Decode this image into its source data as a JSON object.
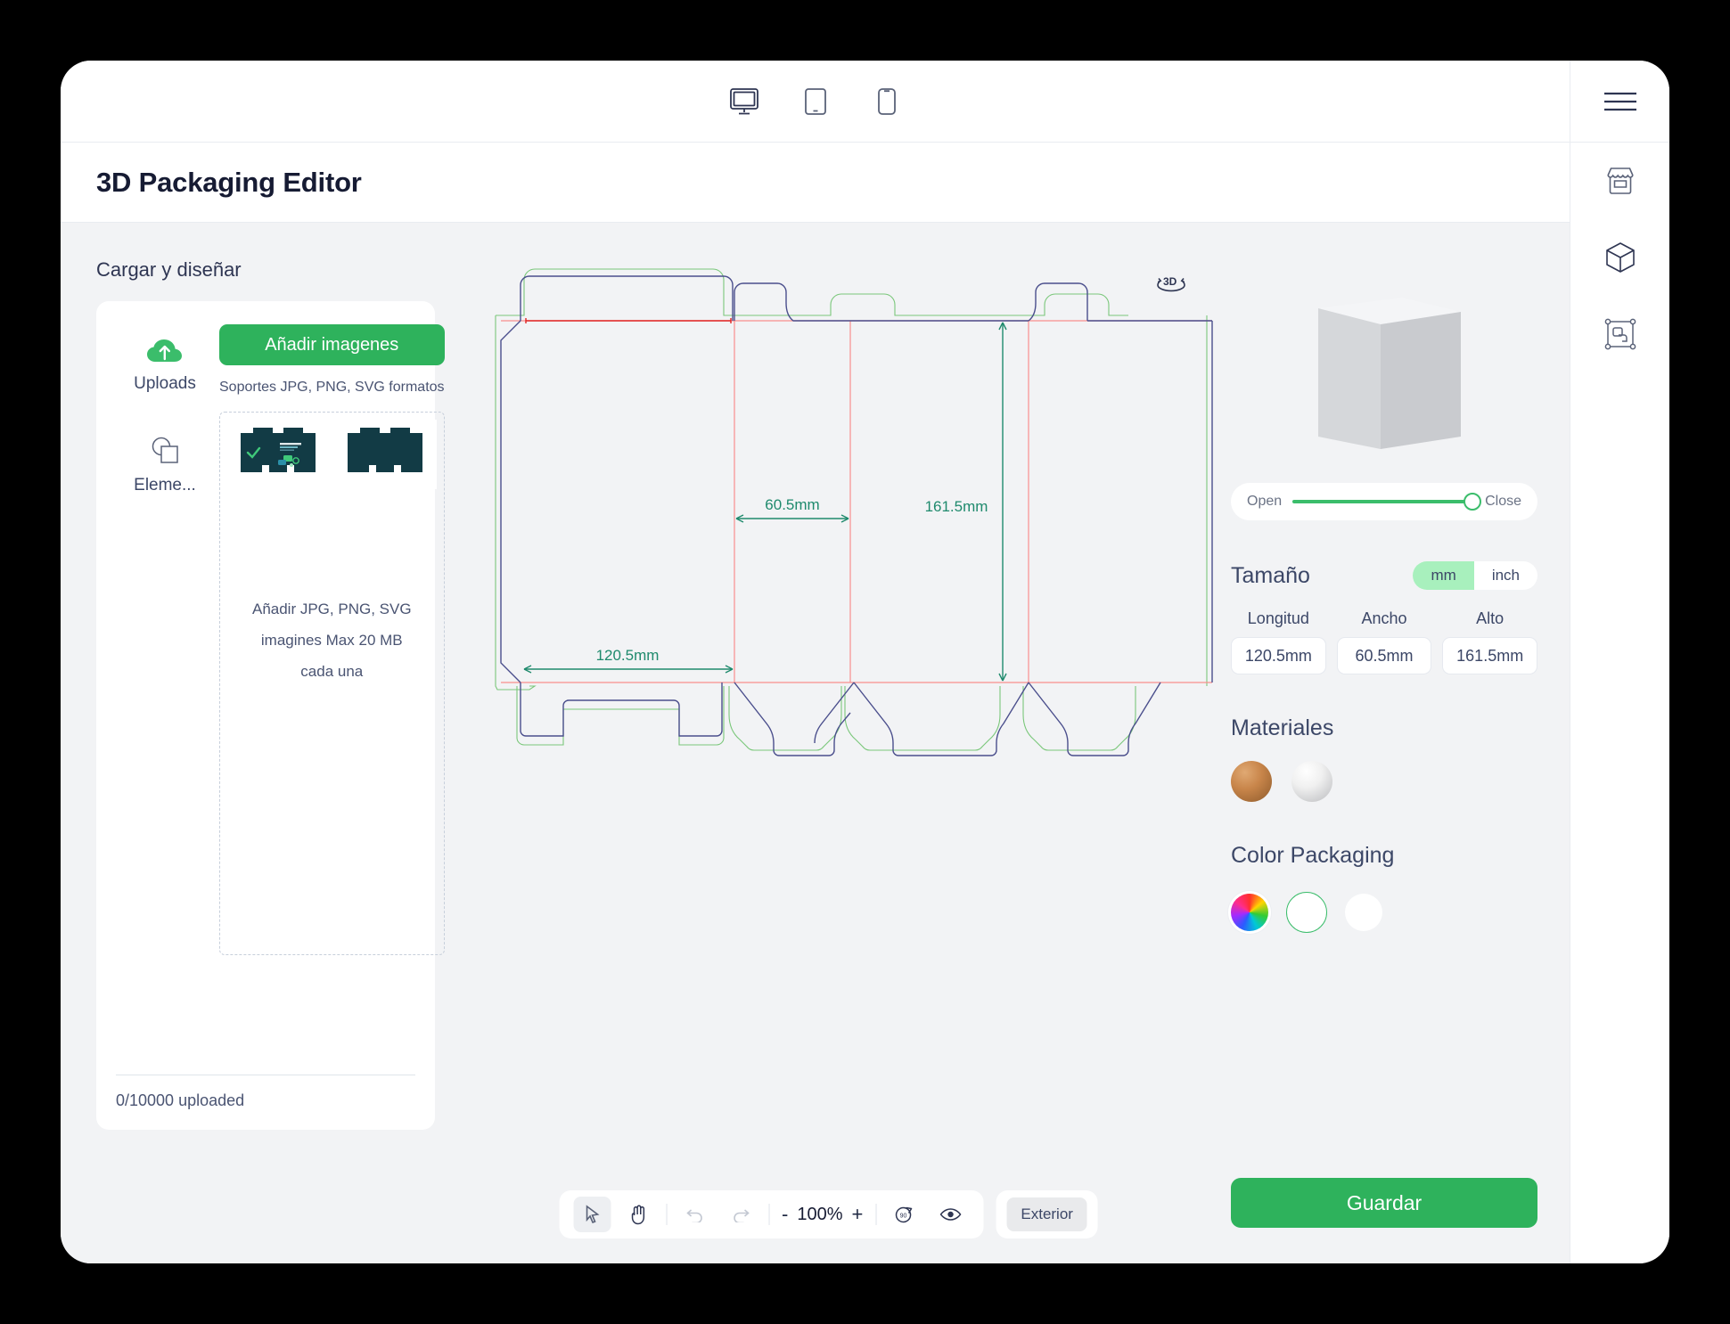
{
  "window": {
    "title": "3D Packaging Editor"
  },
  "device_bar": {
    "items": [
      {
        "name": "desktop-preview",
        "icon": "monitor-icon",
        "label": "Desktop"
      },
      {
        "name": "tablet-preview",
        "icon": "tablet-icon",
        "label": "Tablet"
      },
      {
        "name": "mobile-preview",
        "icon": "phone-icon",
        "label": "Mobile"
      }
    ]
  },
  "left_panel": {
    "section_title": "Cargar y diseñar",
    "tools": [
      {
        "icon": "cloud-upload-icon",
        "label": "Uploads"
      },
      {
        "icon": "shapes-icon",
        "label": "Eleme..."
      }
    ],
    "add_images_button": "Añadir imagenes",
    "formats_note": "Soportes  JPG, PNG, SVG formatos",
    "dropzone": {
      "line1": "Añadir JPG, PNG, SVG",
      "line2": "imagines Max 20 MB",
      "line3": "cada una"
    },
    "thumbnails": [
      {
        "name": "dieline-thumbnail-front",
        "has_artwork": true
      },
      {
        "name": "dieline-thumbnail-back",
        "has_artwork": false
      }
    ],
    "upload_count": "0/10000 uploaded"
  },
  "canvas": {
    "rotate_3d_icon": "rotate-3d-icon",
    "dimensions": {
      "width_label": "60.5mm",
      "height_label": "161.5mm",
      "length_label": "120.5mm"
    },
    "colors": {
      "cut_line": "#4a4e8c",
      "bleed_line": "#7ac77a",
      "fold_line": "#f26a6a",
      "fold_line_strong": "#e02424",
      "dimension": "#1f8a6d"
    }
  },
  "bottom_toolbar": {
    "select_tool": "cursor-icon",
    "pan_tool": "hand-icon",
    "undo": "undo-icon",
    "redo": "redo-icon",
    "zoom_out": "-",
    "zoom_value": "100%",
    "zoom_in": "+",
    "rotate_90": "rotate-90-icon",
    "preview_eye": "eye-icon",
    "side_button": "Exterior"
  },
  "right_panel": {
    "slider": {
      "open_label": "Open",
      "close_label": "Close",
      "value": 100
    },
    "size": {
      "title": "Tamaño",
      "units": [
        {
          "label": "mm",
          "selected": true
        },
        {
          "label": "inch",
          "selected": false
        }
      ],
      "fields": [
        {
          "label": "Longitud",
          "value": "120.5mm"
        },
        {
          "label": "Ancho",
          "value": "60.5mm"
        },
        {
          "label": "Alto",
          "value": "161.5mm"
        }
      ]
    },
    "materials": {
      "title": "Materiales",
      "options": [
        {
          "name": "kraft-material",
          "color": "#c8854a"
        },
        {
          "name": "white-material",
          "color": "#f0f0f0"
        }
      ]
    },
    "color_packaging": {
      "title": "Color Packaging",
      "options": [
        {
          "name": "color-wheel-swatch",
          "type": "wheel"
        },
        {
          "name": "selected-color-swatch",
          "type": "outline",
          "color": "#ffffff"
        },
        {
          "name": "white-color-swatch",
          "type": "plain",
          "color": "#ffffff"
        }
      ]
    },
    "save_button": "Guardar"
  },
  "right_rail": {
    "items": [
      {
        "name": "menu-toggle",
        "icon": "hamburger-icon"
      },
      {
        "name": "rail-store",
        "icon": "store-icon"
      },
      {
        "name": "rail-3d-box",
        "icon": "cube-icon"
      },
      {
        "name": "rail-transform",
        "icon": "transform-icon"
      }
    ]
  },
  "theme": {
    "accent_green": "#2eb25c",
    "page_bg": "#000000",
    "panel_bg": "#f2f3f5",
    "text_dark": "#161b33"
  }
}
